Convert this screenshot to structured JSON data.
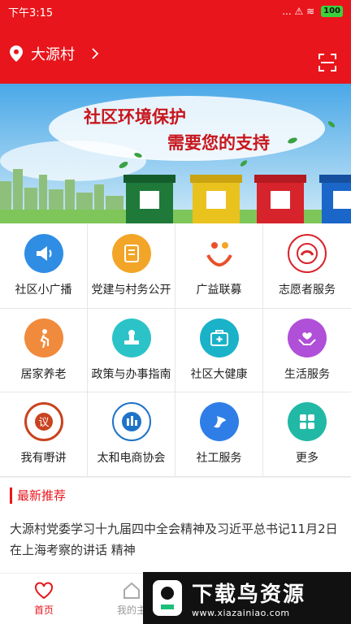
{
  "status_bar": {
    "time": "下午3:15",
    "indicators": "... ⚠ ≋",
    "battery": "100"
  },
  "header": {
    "location": "大源村",
    "icons": {
      "location": "location-pin-icon",
      "chevron": "chevron-right-icon",
      "scan": "scan-icon"
    }
  },
  "banner": {
    "line1": "社区环境保护",
    "line2": "需要您的支持"
  },
  "grid": [
    {
      "label": "社区小广播",
      "icon": "megaphone-icon",
      "color": "#2f8de4"
    },
    {
      "label": "党建与村务公开",
      "icon": "document-icon",
      "color": "#f2a526"
    },
    {
      "label": "广益联募",
      "icon": "charity-icon",
      "color": "#e8502a"
    },
    {
      "label": "志愿者服务",
      "icon": "volunteer-emblem-icon",
      "color": "#d9242b"
    },
    {
      "label": "居家养老",
      "icon": "elderly-icon",
      "color": "#f08a3c"
    },
    {
      "label": "政策与办事指南",
      "icon": "stamp-icon",
      "color": "#2cc3c8"
    },
    {
      "label": "社区大健康",
      "icon": "medical-kit-icon",
      "color": "#1ab2c9"
    },
    {
      "label": "生活服务",
      "icon": "heart-hands-icon",
      "color": "#b04fd8"
    },
    {
      "label": "我有嘢讲",
      "icon": "speech-emblem-icon",
      "color": "#c9431f"
    },
    {
      "label": "太和电商协会",
      "icon": "association-emblem-icon",
      "color": "#1e73c8"
    },
    {
      "label": "社工服务",
      "icon": "social-work-icon",
      "color": "#2f7ee8"
    },
    {
      "label": "更多",
      "icon": "more-grid-icon",
      "color": "#22b8a6"
    }
  ],
  "recommend": {
    "title": "最新推荐",
    "news": "大源村党委学习十九届四中全会精神及习近平总书记11月2日在上海考察的讲话 精神"
  },
  "tabbar": [
    {
      "label": "首页",
      "icon": "home-heart-icon",
      "active": true
    },
    {
      "label": "我的主",
      "icon": "home-icon",
      "active": false
    }
  ],
  "watermark": {
    "title": "下载鸟资源",
    "url": "www.xiazainiao.com"
  }
}
